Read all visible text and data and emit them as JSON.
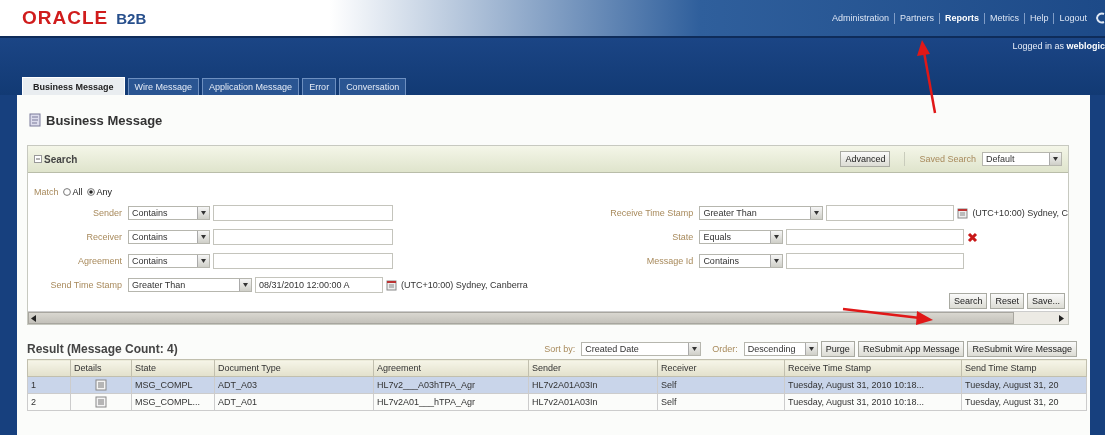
{
  "header": {
    "logo": {
      "brand": "ORACLE",
      "product": "B2B"
    },
    "nav": [
      {
        "label": "Administration",
        "selected": false
      },
      {
        "label": "Partners",
        "selected": false
      },
      {
        "label": "Reports",
        "selected": true
      },
      {
        "label": "Metrics",
        "selected": false
      },
      {
        "label": "Help",
        "selected": false
      },
      {
        "label": "Logout",
        "selected": false
      }
    ],
    "user": {
      "prefix": "Logged in as",
      "name": "weblogic"
    }
  },
  "tabs": [
    {
      "label": "Business Message",
      "selected": true
    },
    {
      "label": "Wire Message",
      "selected": false
    },
    {
      "label": "Application Message",
      "selected": false
    },
    {
      "label": "Error",
      "selected": false
    },
    {
      "label": "Conversation",
      "selected": false
    }
  ],
  "page": {
    "title": "Business Message"
  },
  "search": {
    "title": "Search",
    "advanced_button": "Advanced",
    "saved_search": {
      "label": "Saved Search",
      "value": "Default"
    },
    "match": {
      "label": "Match",
      "options": [
        {
          "label": "All",
          "selected": false
        },
        {
          "label": "Any",
          "selected": true
        }
      ]
    },
    "left_fields": [
      {
        "kind": "text",
        "label": "Sender",
        "operator": "Contains"
      },
      {
        "kind": "text",
        "label": "Receiver",
        "operator": "Contains"
      },
      {
        "kind": "text",
        "label": "Agreement",
        "operator": "Contains"
      },
      {
        "kind": "date",
        "label": "Send Time Stamp",
        "operator": "Greater Than",
        "value": "08/31/2010 12:00:00 A",
        "timezone": "(UTC+10:00) Sydney, Canberra"
      }
    ],
    "right_fields": [
      {
        "kind": "date",
        "label": "Receive Time Stamp",
        "operator": "Greater Than",
        "timezone": "(UTC+10:00) Sydney, C"
      },
      {
        "kind": "text",
        "label": "State",
        "operator": "Equals",
        "clearable": true
      },
      {
        "kind": "text",
        "label": "Message Id",
        "operator": "Contains"
      }
    ],
    "buttons": [
      "Search",
      "Reset",
      "Save..."
    ]
  },
  "result": {
    "title": "Result (Message Count: 4)",
    "sort_by": {
      "label": "Sort by:",
      "value": "Created Date"
    },
    "order": {
      "label": "Order:",
      "value": "Descending"
    },
    "buttons": [
      "Purge",
      "ReSubmit App Message",
      "ReSubmit Wire Message"
    ],
    "table": {
      "columns": [
        "",
        "Details",
        "State",
        "Document Type",
        "Agreement",
        "Sender",
        "Receiver",
        "Receive Time Stamp",
        "Send Time Stamp"
      ],
      "rows": [
        {
          "selected": true,
          "cells": [
            "1",
            "",
            "MSG_COMPL",
            "ADT_A03",
            "HL7v2___A03hTPA_Agr",
            "HL7v2A01A03In",
            "Self",
            "Tuesday, August 31, 2010 10:18...",
            "Tuesday, August 31, 20"
          ]
        },
        {
          "selected": false,
          "cells": [
            "2",
            "",
            "MSG_COMPL...",
            "ADT_A01",
            "HL7v2A01___hTPA_Agr",
            "HL7v2A01A03In",
            "Self",
            "Tuesday, August 31, 2010 10:18...",
            "Tuesday, August 31, 20"
          ]
        }
      ]
    }
  },
  "annotation_arrows": [
    {
      "kind": "arrow"
    },
    {
      "kind": "arrow"
    }
  ]
}
